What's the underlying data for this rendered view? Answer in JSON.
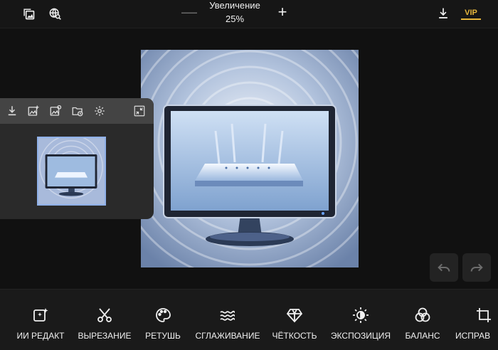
{
  "topbar": {
    "zoom_label": "Увеличение",
    "zoom_value": "25%",
    "zoom_minus": "—",
    "zoom_plus": "+",
    "vip_label": "VIP"
  },
  "tools": [
    {
      "label": "ИИ РЕДАКТ",
      "icon": "ai-sparkle-icon"
    },
    {
      "label": "ВЫРЕЗАНИЕ",
      "icon": "scissors-icon"
    },
    {
      "label": "РЕТУШЬ",
      "icon": "palette-icon"
    },
    {
      "label": "СГЛАЖИВАНИЕ",
      "icon": "waves-icon"
    },
    {
      "label": "ЧЁТКОСТЬ",
      "icon": "diamond-icon"
    },
    {
      "label": "ЭКСПОЗИЦИЯ",
      "icon": "exposure-icon"
    },
    {
      "label": "БАЛАНС",
      "icon": "color-balance-icon"
    },
    {
      "label": "ИСПРАВ",
      "icon": "crop-icon"
    }
  ],
  "colors": {
    "accent": "#e6b63c",
    "background": "#111111",
    "panel": "#2a2a2a",
    "thumb_border": "#8fb0e8"
  }
}
